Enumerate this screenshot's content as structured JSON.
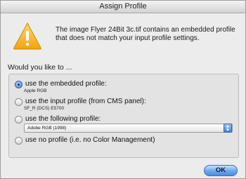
{
  "window": {
    "title": "Assign Profile"
  },
  "icons": {
    "warning": "warning-triangle-icon",
    "warning_color": "#f2b21b"
  },
  "message": "The image Flyer 24Bit 3c.tif contains an embedded profile that does not match your input profile settings.",
  "prompt": "Would you like to ...",
  "options": [
    {
      "label": "use the embedded profile:",
      "sub": "Apple RGB",
      "checked": true
    },
    {
      "label": "use the input profile (from CMS panel):",
      "sub": "SF_R (DCS) E5700",
      "checked": false
    },
    {
      "label": "use the following profile:",
      "checked": false
    },
    {
      "label": "use no profile (i.e. no Color Management)",
      "checked": false
    }
  ],
  "profile_select": {
    "selected": "Adobe RGB (1998)"
  },
  "ok_button": {
    "label": "OK"
  }
}
